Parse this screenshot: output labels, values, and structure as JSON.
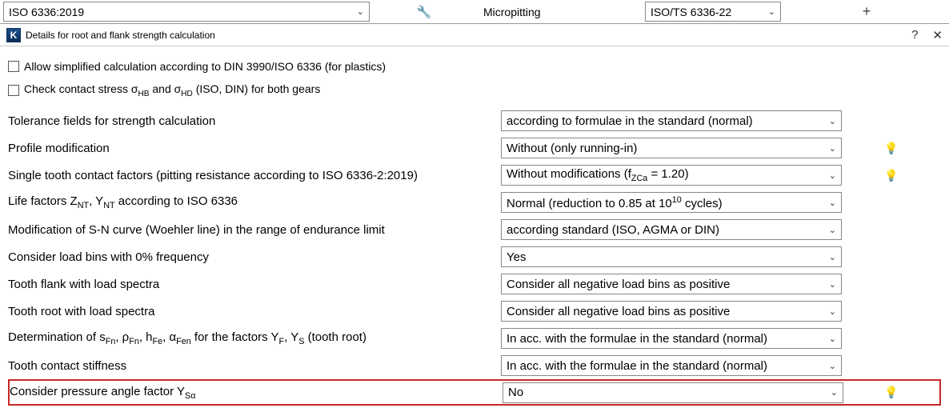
{
  "topbar": {
    "main_select": "ISO 6336:2019",
    "mp_label": "Micropitting",
    "mp_select": "ISO/TS 6336-22"
  },
  "dialog": {
    "title": "Details for root and flank strength calculation"
  },
  "checkboxes": {
    "allow_simplified": "Allow simplified calculation according to DIN 3990/ISO 6336 (for plastics)",
    "check_contact": "Check contact stress σ"
  },
  "check_contact_rest": " (ISO, DIN) for both gears",
  "rows": {
    "tolerance": {
      "label": "Tolerance fields for strength calculation",
      "value": "according to formulae in the standard (normal)"
    },
    "profile": {
      "label": "Profile modification",
      "value": "Without (only running-in)"
    },
    "single_tooth": {
      "label": "Single tooth contact factors (pitting resistance according to ISO 6336-2:2019)",
      "value_prefix": "Without modifications (f",
      "value_suffix": " = 1.20)"
    },
    "life_factors": {
      "label_prefix": "Life factors Z",
      "label_mid": ", Y",
      "label_suffix": " according to ISO 6336",
      "value_prefix": "Normal (reduction to 0.85 at 10",
      "value_suffix": " cycles)"
    },
    "sncurve": {
      "label": "Modification of S-N curve (Woehler line) in the range of endurance limit",
      "value": "according standard (ISO, AGMA or DIN)"
    },
    "loadbins": {
      "label": "Consider load bins with 0% frequency",
      "value": "Yes"
    },
    "flank_spectra": {
      "label": "Tooth flank with load spectra",
      "value": "Consider all negative load bins as positive"
    },
    "root_spectra": {
      "label": "Tooth root with load spectra",
      "value": "Consider all negative load bins as positive"
    },
    "determination": {
      "label_prefix": "Determination of s",
      "label_mid1": ", ρ",
      "label_mid2": ", h",
      "label_mid3": ", α",
      "label_mid4": " for the factors Y",
      "label_mid5": ", Y",
      "label_suffix": " (tooth root)",
      "value": "In acc. with the formulae in the standard (normal)"
    },
    "stiffness": {
      "label": "Tooth contact stiffness",
      "value": "In acc. with the formulae in the standard (normal)"
    },
    "pressure_angle": {
      "label_prefix": "Consider pressure angle factor Y",
      "value": "No"
    }
  },
  "subs": {
    "HB": "HB",
    "HD": "HD",
    "and": " and σ",
    "ZCa": "ZCa",
    "NT": "NT",
    "ten": "10",
    "Fn": "Fn",
    "Fe": "Fe",
    "Fen": "Fen",
    "F": "F",
    "S": "S",
    "Sa": "Sα"
  }
}
